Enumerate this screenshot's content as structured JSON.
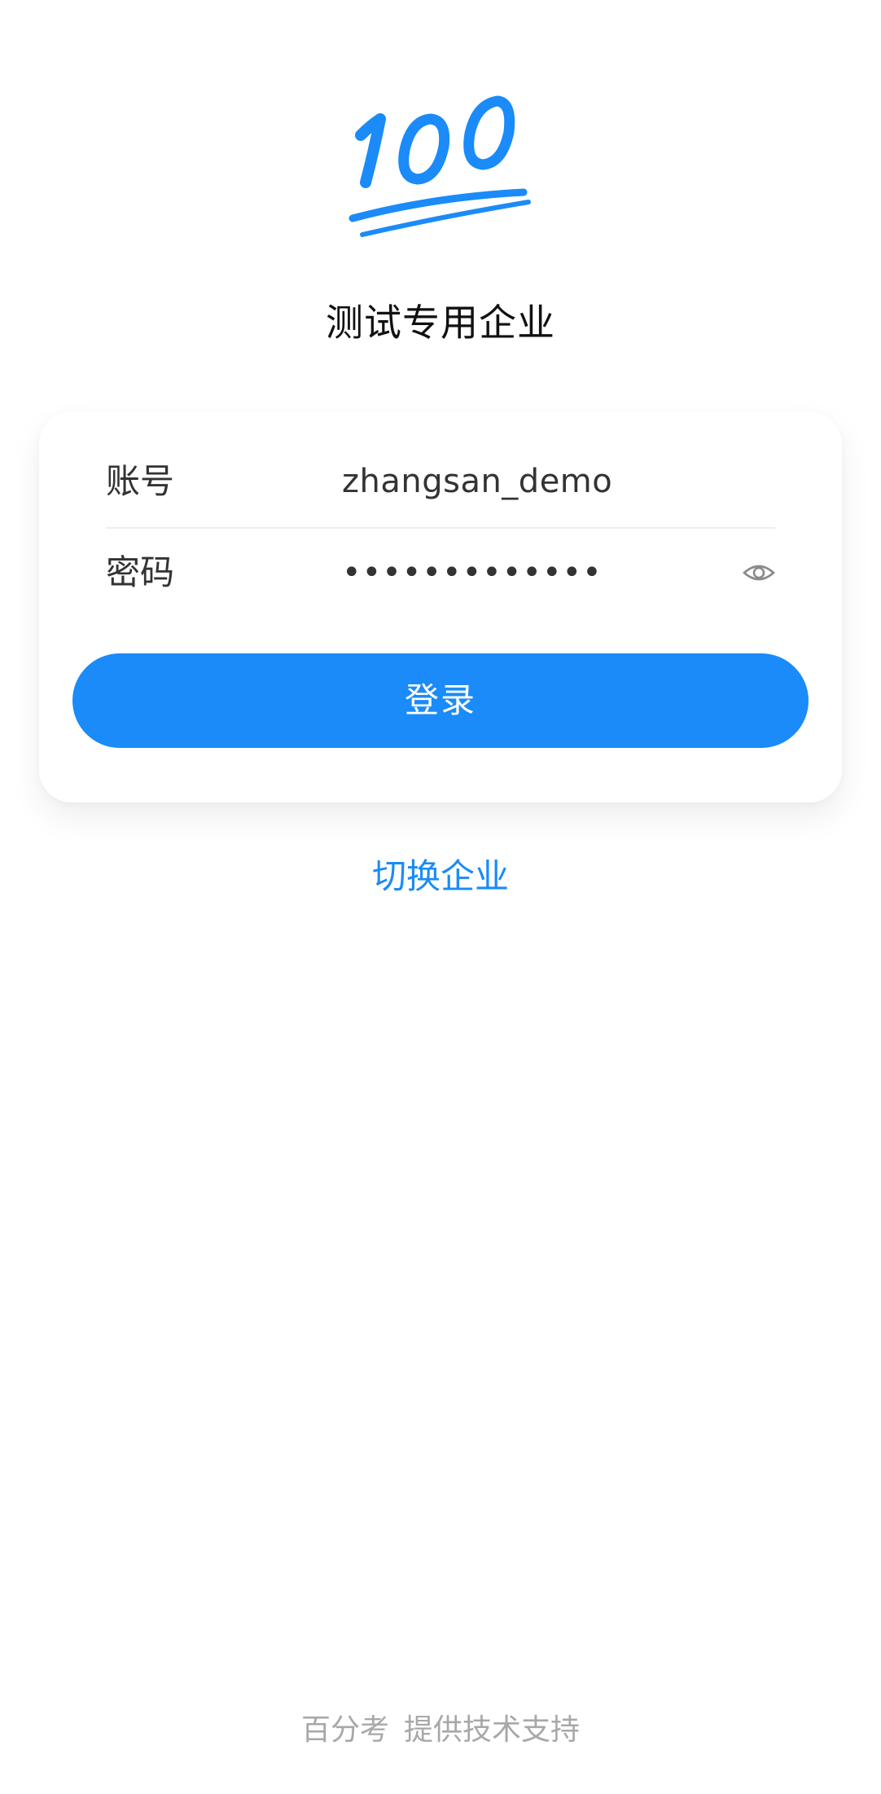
{
  "logo": {
    "text": "100",
    "color": "#1a8bf8"
  },
  "company": {
    "name": "测试专用企业"
  },
  "form": {
    "account_label": "账号",
    "account_value": "zhangsan_demo",
    "password_label": "密码",
    "password_masked": "•••••••••••••",
    "eye_icon": "eye-icon",
    "login_label": "登录"
  },
  "switch_company_label": "切换企业",
  "footer": {
    "brand": "百分考",
    "support_text": "提供技术支持"
  },
  "colors": {
    "accent": "#1a8bf8",
    "footer_text": "#a8a8a8"
  }
}
